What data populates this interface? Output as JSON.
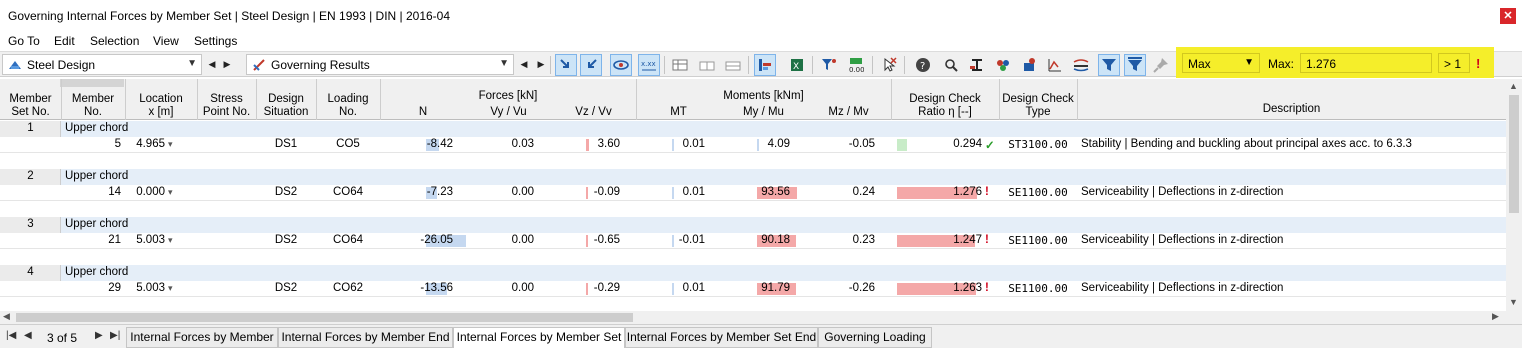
{
  "window": {
    "title": "Governing Internal Forces by Member Set | Steel Design | EN 1993 | DIN | 2016-04"
  },
  "menu": [
    "Go To",
    "Edit",
    "Selection",
    "View",
    "Settings"
  ],
  "toolbar": {
    "module_combo": "Steel Design",
    "results_combo": "Governing Results",
    "filter_mode": "Max",
    "max_label": "Max:",
    "max_value": "1.276",
    "threshold": "> 1",
    "colors": {
      "highlight": "#f5ee2a",
      "active_button": "#cce4f7"
    }
  },
  "table": {
    "headers": {
      "member_set": "Member\nSet No.",
      "member": "Member\nNo.",
      "location": "Location\nx [m]",
      "stress_point": "Stress\nPoint No.",
      "design_situation": "Design\nSituation",
      "loading": "Loading\nNo.",
      "forces_group": "Forces [kN]",
      "n": "N",
      "vy": "Vy / Vu",
      "vz": "Vz / Vv",
      "moments_group": "Moments [kNm]",
      "mt": "MT",
      "my": "My / Mu",
      "mz": "Mz / Mv",
      "ratio": "Design Check\nRatio η [--]",
      "type": "Design Check\nType",
      "description": "Description"
    },
    "sets": [
      {
        "set_no": "1",
        "name": "Upper chord",
        "member": "5",
        "location": "4.965",
        "stress_point": "",
        "ds": "DS1",
        "loading": "CO5",
        "n": "-8.42",
        "vy": "0.03",
        "vz": "3.60",
        "mt": "0.01",
        "my": "4.09",
        "mz": "-0.05",
        "ratio": "0.294",
        "ratio_state": "ok",
        "type": "ST3100.00",
        "description": "Stability | Bending and buckling about principal axes acc. to 6.3.3"
      },
      {
        "set_no": "2",
        "name": "Upper chord",
        "member": "14",
        "location": "0.000",
        "stress_point": "",
        "ds": "DS2",
        "loading": "CO64",
        "n": "-7.23",
        "vy": "0.00",
        "vz": "-0.09",
        "mt": "0.01",
        "my": "93.56",
        "mz": "0.24",
        "ratio": "1.276",
        "ratio_state": "fail",
        "type": "SE1100.00",
        "description": "Serviceability | Deflections in z-direction"
      },
      {
        "set_no": "3",
        "name": "Upper chord",
        "member": "21",
        "location": "5.003",
        "stress_point": "",
        "ds": "DS2",
        "loading": "CO64",
        "n": "-26.05",
        "vy": "0.00",
        "vz": "-0.65",
        "mt": "-0.01",
        "my": "90.18",
        "mz": "0.23",
        "ratio": "1.247",
        "ratio_state": "fail",
        "type": "SE1100.00",
        "description": "Serviceability | Deflections in z-direction"
      },
      {
        "set_no": "4",
        "name": "Upper chord",
        "member": "29",
        "location": "5.003",
        "stress_point": "",
        "ds": "DS2",
        "loading": "CO62",
        "n": "-13.56",
        "vy": "0.00",
        "vz": "-0.29",
        "mt": "0.01",
        "my": "91.79",
        "mz": "-0.26",
        "ratio": "1.263",
        "ratio_state": "fail",
        "type": "SE1100.00",
        "description": "Serviceability | Deflections in z-direction"
      }
    ]
  },
  "pager": {
    "label": "3 of 5"
  },
  "tabs": [
    {
      "label": "Internal Forces by Member",
      "active": false
    },
    {
      "label": "Internal Forces by Member End",
      "active": false
    },
    {
      "label": "Internal Forces by Member Set",
      "active": true
    },
    {
      "label": "Internal Forces by Member Set End",
      "active": false
    },
    {
      "label": "Governing Loading",
      "active": false
    }
  ]
}
